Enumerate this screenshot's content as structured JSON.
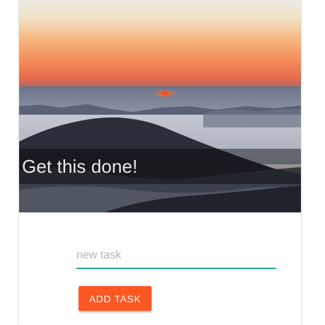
{
  "hero": {
    "image": "sunrise-over-misty-mountains",
    "title": "Get this done!"
  },
  "form": {
    "input_placeholder": "new task",
    "input_value": "",
    "add_button_label": "ADD TASK"
  },
  "colors": {
    "input_underline": "#26a69a",
    "button_background": "#ff5722",
    "button_text": "#ffffff",
    "title_text": "#e9e9e9"
  }
}
